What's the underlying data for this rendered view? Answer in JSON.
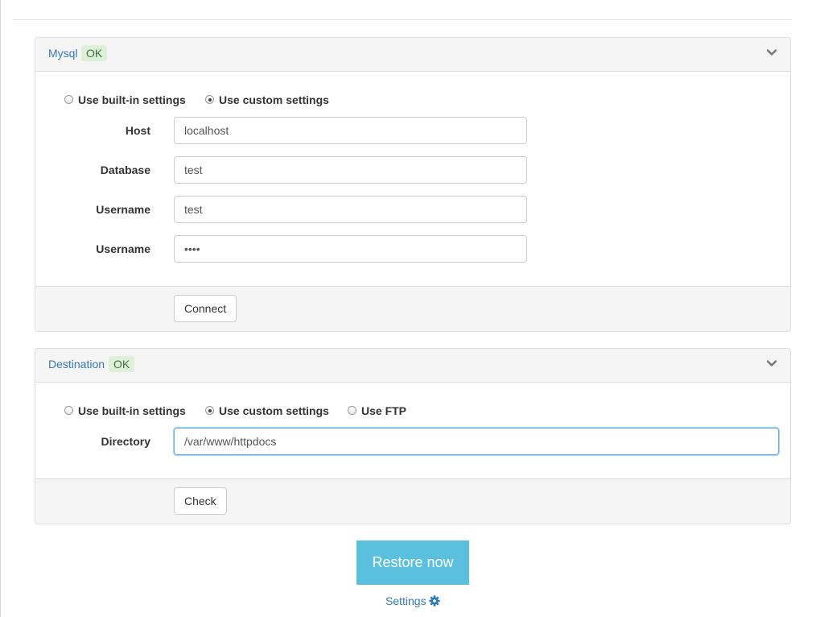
{
  "mysql": {
    "title": "Mysql",
    "status": "OK",
    "radios": [
      {
        "label": "Use built-in settings",
        "checked": false
      },
      {
        "label": "Use custom settings",
        "checked": true
      }
    ],
    "fields": [
      {
        "label": "Host",
        "value": "localhost"
      },
      {
        "label": "Database",
        "value": "test"
      },
      {
        "label": "Username",
        "value": "test"
      },
      {
        "label": "Username",
        "value": "••••"
      }
    ],
    "button": "Connect"
  },
  "destination": {
    "title": "Destination",
    "status": "OK",
    "radios": [
      {
        "label": "Use built-in settings",
        "checked": false
      },
      {
        "label": "Use custom settings",
        "checked": true
      },
      {
        "label": "Use FTP",
        "checked": false
      }
    ],
    "directory_label": "Directory",
    "directory_value": "/var/www/httpdocs",
    "button": "Check"
  },
  "restore_button": "Restore now",
  "settings_link": "Settings",
  "colors": {
    "link": "#337ab7",
    "ok_bg": "#dff0d8",
    "ok_text": "#3c763d",
    "primary": "#5bc0de",
    "focus": "#66afe9"
  },
  "icons": {
    "collapse": "chevron-down-icon",
    "settings": "gear-icon"
  }
}
